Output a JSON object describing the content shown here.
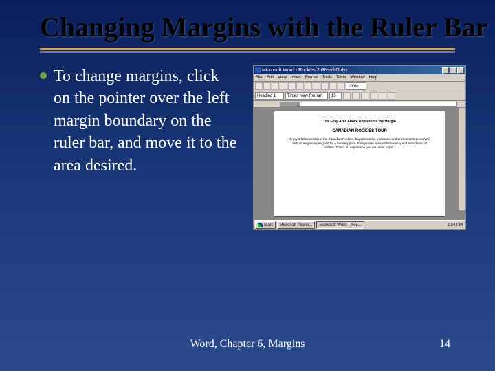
{
  "slide": {
    "title": "Changing Margins with the Ruler Bar",
    "bullet": "To change margins, click on the pointer over the left margin boundary on the ruler bar, and move it to the area desired.",
    "footer_center": "Word, Chapter 6, Margins",
    "footer_page": "14"
  },
  "screenshot": {
    "app_title": "Microsoft Word - Rockies 2 (Read-Only)",
    "menus": [
      "File",
      "Edit",
      "View",
      "Insert",
      "Format",
      "Tools",
      "Table",
      "Window",
      "Help"
    ],
    "zoom": "100%",
    "style_combo": "Heading 1",
    "font_combo": "Times New Roman",
    "size_combo": "16",
    "callout": "The Gray Area Above Represents the Margin",
    "doc_title": "CANADIAN ROCKIES TOUR",
    "doc_para": "Enjoy a fabulous stay in the Canadian Rockies. Experience the mountains and environment preserved with an elegance designed for a leisurely pace. Everywhere is beautiful scenery and abundance of wildlife. This is an experience you will never forget.",
    "taskbar": {
      "start": "Start",
      "items": [
        "Microsoft Power...",
        "Microsoft Word - Roc..."
      ],
      "clock": "2:34 PM"
    }
  }
}
